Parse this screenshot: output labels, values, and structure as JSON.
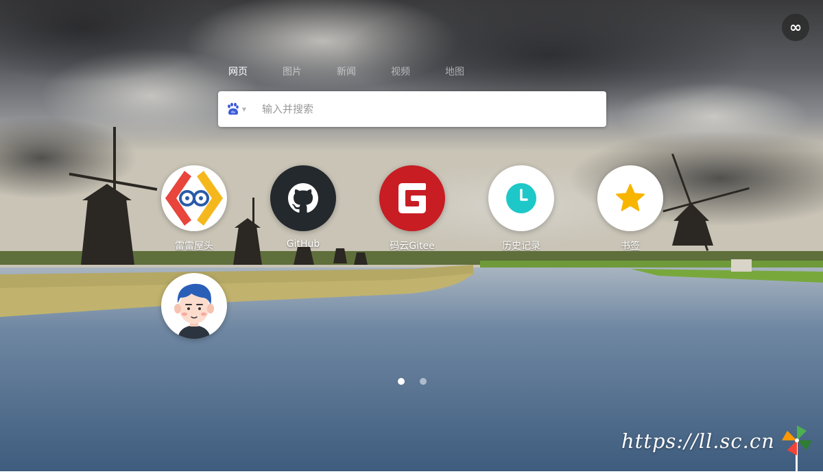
{
  "top_right": {
    "icon": "infinity-icon",
    "glyph": "∞"
  },
  "tabs": [
    {
      "label": "网页",
      "active": true
    },
    {
      "label": "图片",
      "active": false
    },
    {
      "label": "新闻",
      "active": false
    },
    {
      "label": "视频",
      "active": false
    },
    {
      "label": "地图",
      "active": false
    }
  ],
  "search": {
    "engine_icon": "baidu-paw-icon",
    "placeholder": "输入并搜索",
    "value": ""
  },
  "apps": [
    {
      "label": "雷雷屋头",
      "icon": "leilei-logo-icon"
    },
    {
      "label": "GitHub",
      "icon": "github-icon"
    },
    {
      "label": "码云Gitee",
      "icon": "gitee-icon"
    },
    {
      "label": "历史记录",
      "icon": "clock-icon"
    },
    {
      "label": "书签",
      "icon": "star-icon"
    },
    {
      "label": "",
      "icon": "avatar-icon"
    }
  ],
  "pagination": {
    "pages": 2,
    "current": 1
  },
  "watermark": {
    "text": "https://ll.sc.cn",
    "icon": "pinwheel-icon"
  },
  "colors": {
    "gitee_red": "#c71d23",
    "clock_teal": "#1ec8c8",
    "star_yellow": "#f7b500",
    "github_dark": "#24292e"
  }
}
